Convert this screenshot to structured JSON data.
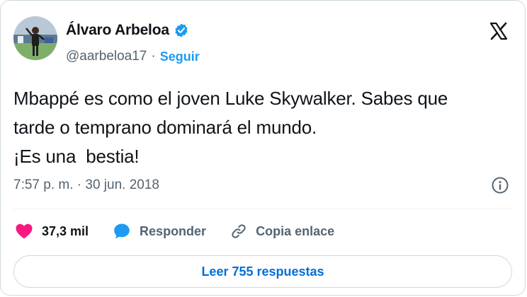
{
  "author": {
    "name": "Álvaro Arbeloa",
    "handle": "@aarbeloa17",
    "separator": "·",
    "follow_label": "Seguir"
  },
  "tweet": {
    "text": "Mbappé es como el joven Luke Skywalker. Sabes que\ntarde o temprano dominará el mundo.\n¡Es una  bestia!",
    "timestamp": "7:57 p. m. · 30 jun. 2018"
  },
  "actions": {
    "likes": "37,3 mil",
    "reply_label": "Responder",
    "copy_label": "Copia enlace"
  },
  "read_replies_label": "Leer 755 respuestas",
  "icons": {
    "verified": "verified-badge-icon",
    "platform": "x-logo-icon",
    "info": "info-icon",
    "like": "heart-icon",
    "reply": "speech-bubble-icon",
    "copy": "link-icon"
  },
  "colors": {
    "accent": "#1d9bf0",
    "like": "#f91880",
    "text": "#0f1419",
    "muted": "#536471",
    "border": "#cfd9de"
  }
}
